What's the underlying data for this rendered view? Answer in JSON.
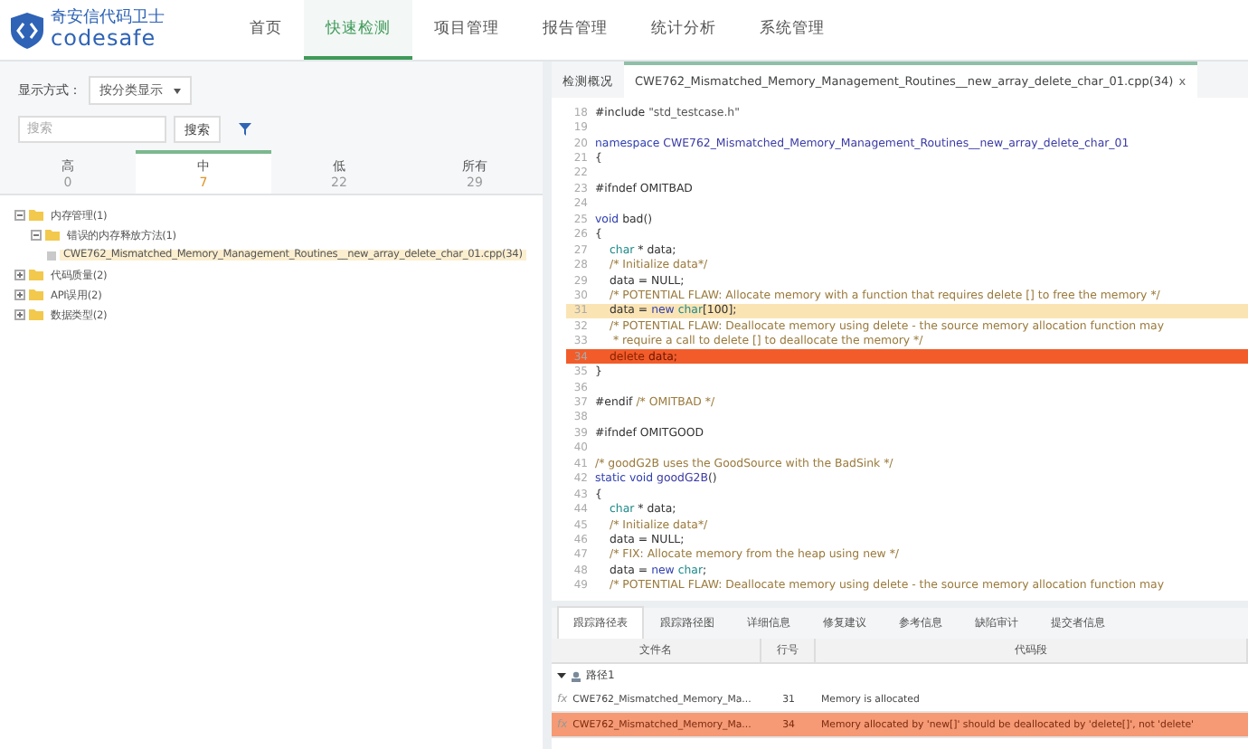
{
  "header": {
    "logo": {
      "title": "奇安信代码卫士",
      "subtitle": "codesafe"
    },
    "nav": [
      {
        "label": "首页",
        "selected": false
      },
      {
        "label": "快速检测",
        "selected": true
      },
      {
        "label": "项目管理",
        "selected": false
      },
      {
        "label": "报告管理",
        "selected": false
      },
      {
        "label": "统计分析",
        "selected": false
      },
      {
        "label": "系统管理",
        "selected": false
      }
    ]
  },
  "left_panel": {
    "display_mode": {
      "label": "显示方式：",
      "value": "按分类显示"
    },
    "search": {
      "placeholder": "搜索",
      "button": "搜索"
    },
    "severity_tabs": [
      {
        "label": "高",
        "count": "0",
        "selected": false
      },
      {
        "label": "中",
        "count": "7",
        "selected": true
      },
      {
        "label": "低",
        "count": "22",
        "selected": false
      },
      {
        "label": "所有",
        "count": "29",
        "selected": false
      }
    ],
    "tree": [
      {
        "label": "内存管理(1)",
        "expanded": true,
        "children": [
          {
            "label": "错误的内存释放方法(1)",
            "expanded": true,
            "children": [
              {
                "label": "CWE762_Mismatched_Memory_Management_Routines__new_array_delete_char_01.cpp(34)",
                "selected": true
              }
            ]
          }
        ]
      },
      {
        "label": "代码质量(2)",
        "expanded": false
      },
      {
        "label": "API误用(2)",
        "expanded": false
      },
      {
        "label": "数据类型(2)",
        "expanded": false
      }
    ]
  },
  "editor": {
    "tabs": [
      {
        "label": "检测概况",
        "selected": false,
        "closable": false
      },
      {
        "label": "CWE762_Mismatched_Memory_Management_Routines__new_array_delete_char_01.cpp(34)",
        "selected": true,
        "closable": true,
        "close": "x"
      }
    ],
    "lines": [
      {
        "num": "18",
        "segments": [
          {
            "kind": "plain",
            "text": "#include "
          },
          {
            "kind": "str",
            "text": "\"std_testcase.h\""
          }
        ]
      },
      {
        "num": "19"
      },
      {
        "num": "20",
        "segments": [
          {
            "kind": "kw",
            "text": "namespace "
          },
          {
            "kind": "name",
            "text": "CWE762_Mismatched_Memory_Management_Routines__new_array_delete_char_01"
          }
        ]
      },
      {
        "num": "21",
        "segments": [
          {
            "kind": "plain",
            "text": "{"
          }
        ]
      },
      {
        "num": "22"
      },
      {
        "num": "23",
        "segments": [
          {
            "kind": "plain",
            "text": "#ifndef OMITBAD"
          }
        ]
      },
      {
        "num": "24"
      },
      {
        "num": "25",
        "segments": [
          {
            "kind": "kw",
            "text": "void "
          },
          {
            "kind": "plain",
            "text": "bad()"
          }
        ]
      },
      {
        "num": "26",
        "segments": [
          {
            "kind": "plain",
            "text": "{"
          }
        ]
      },
      {
        "num": "27",
        "indented": true,
        "segments": [
          {
            "kind": "type",
            "text": "char "
          },
          {
            "kind": "plain",
            "text": "* data;"
          }
        ]
      },
      {
        "num": "28",
        "indented": true,
        "segments": [
          {
            "kind": "comment",
            "text": "/* Initialize data*/"
          }
        ]
      },
      {
        "num": "29",
        "indented": true,
        "segments": [
          {
            "kind": "plain",
            "text": "data = NULL;"
          }
        ]
      },
      {
        "num": "30",
        "indented": true,
        "segments": [
          {
            "kind": "comment",
            "text": "/* POTENTIAL FLAW: Allocate memory with a function that requires delete [] to free the memory */"
          }
        ]
      },
      {
        "num": "31",
        "indented": true,
        "highlighted": true,
        "error": false,
        "segments": [
          {
            "kind": "plain",
            "text": "data = "
          },
          {
            "kind": "kw",
            "text": "new "
          },
          {
            "kind": "type",
            "text": "char"
          },
          {
            "kind": "plain",
            "text": "[100];"
          }
        ]
      },
      {
        "num": "32",
        "indented": true,
        "segments": [
          {
            "kind": "comment",
            "text": "/* POTENTIAL FLAW: Deallocate memory using delete - the source memory allocation function may"
          }
        ]
      },
      {
        "num": "33",
        "indented": true,
        "segments": [
          {
            "kind": "comment",
            "text": " * require a call to delete [] to deallocate the memory */"
          }
        ]
      },
      {
        "num": "34",
        "indented": true,
        "highlighted": true,
        "error": true,
        "segments": [
          {
            "kind": "kw",
            "text": "delete "
          },
          {
            "kind": "plain",
            "text": "data;"
          }
        ]
      },
      {
        "num": "35",
        "segments": [
          {
            "kind": "plain",
            "text": "}"
          }
        ]
      },
      {
        "num": "36"
      },
      {
        "num": "37",
        "segments": [
          {
            "kind": "plain",
            "text": "#endif "
          },
          {
            "kind": "comment",
            "text": "/* OMITBAD */"
          }
        ]
      },
      {
        "num": "38"
      },
      {
        "num": "39",
        "segments": [
          {
            "kind": "plain",
            "text": "#ifndef OMITGOOD"
          }
        ]
      },
      {
        "num": "40"
      },
      {
        "num": "41",
        "segments": [
          {
            "kind": "comment",
            "text": "/* goodG2B uses the GoodSource with the BadSink */"
          }
        ]
      },
      {
        "num": "42",
        "segments": [
          {
            "kind": "kw",
            "text": "static void "
          },
          {
            "kind": "name",
            "text": "goodG2B"
          },
          {
            "kind": "plain",
            "text": "()"
          }
        ]
      },
      {
        "num": "43",
        "segments": [
          {
            "kind": "plain",
            "text": "{"
          }
        ]
      },
      {
        "num": "44",
        "indented": true,
        "segments": [
          {
            "kind": "type",
            "text": "char "
          },
          {
            "kind": "plain",
            "text": "* data;"
          }
        ]
      },
      {
        "num": "45",
        "indented": true,
        "segments": [
          {
            "kind": "comment",
            "text": "/* Initialize data*/"
          }
        ]
      },
      {
        "num": "46",
        "indented": true,
        "segments": [
          {
            "kind": "plain",
            "text": "data = NULL;"
          }
        ]
      },
      {
        "num": "47",
        "indented": true,
        "segments": [
          {
            "kind": "comment",
            "text": "/* FIX: Allocate memory from the heap using new */"
          }
        ]
      },
      {
        "num": "48",
        "indented": true,
        "segments": [
          {
            "kind": "plain",
            "text": "data = "
          },
          {
            "kind": "kw",
            "text": "new "
          },
          {
            "kind": "type",
            "text": "char"
          },
          {
            "kind": "plain",
            "text": ";"
          }
        ]
      },
      {
        "num": "49",
        "indented": true,
        "segments": [
          {
            "kind": "comment",
            "text": "/* POTENTIAL FLAW: Deallocate memory using delete - the source memory allocation function may"
          }
        ]
      }
    ]
  },
  "bottom_panel": {
    "tabs": [
      {
        "label": "跟踪路径表",
        "selected": true
      },
      {
        "label": "跟踪路径图",
        "selected": false
      },
      {
        "label": "详细信息",
        "selected": false
      },
      {
        "label": "修复建议",
        "selected": false
      },
      {
        "label": "参考信息",
        "selected": false
      },
      {
        "label": "缺陷审计",
        "selected": false
      },
      {
        "label": "提交者信息",
        "selected": false
      }
    ],
    "table": {
      "columns": [
        "文件名",
        "行号",
        "代码段"
      ],
      "groups": [
        {
          "label": "路径1",
          "expanded": true,
          "rows": [
            {
              "marker": "fx",
              "file": "CWE762_Mismatched_Memory_Ma...",
              "line": "31",
              "snippet": "Memory is allocated",
              "selected": false
            },
            {
              "marker": "fx",
              "file": "CWE762_Mismatched_Memory_Ma...",
              "line": "34",
              "snippet": "Memory allocated by 'new[]' should be deallocated by 'delete[]', not 'delete'",
              "selected": true
            }
          ]
        }
      ]
    }
  }
}
